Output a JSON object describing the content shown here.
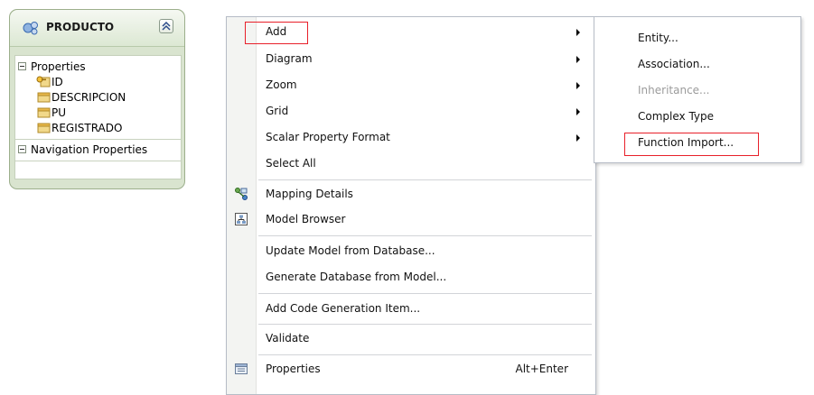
{
  "entity": {
    "title": "PRODUCTO",
    "collapse_icon": "double-chevron-up-icon",
    "properties_label": "Properties",
    "properties": [
      "ID",
      "DESCRIPCION",
      "PU",
      "REGISTRADO"
    ],
    "navigation_label": "Navigation Properties"
  },
  "menu": {
    "add": "Add",
    "diagram": "Diagram",
    "zoom": "Zoom",
    "grid": "Grid",
    "scalar_property_format": "Scalar Property Format",
    "select_all": "Select All",
    "mapping_details": "Mapping Details",
    "model_browser": "Model Browser",
    "update_model": "Update Model from Database...",
    "generate_database": "Generate Database from Model...",
    "add_code_generation": "Add Code Generation Item...",
    "validate": "Validate",
    "properties": "Properties",
    "properties_shortcut": "Alt+Enter"
  },
  "submenu": {
    "entity": "Entity...",
    "association": "Association...",
    "inheritance": "Inheritance...",
    "complex_type": "Complex Type",
    "function_import": "Function Import..."
  },
  "colors": {
    "highlight": "#e8202a",
    "entity_fill": "#d9e4cf",
    "disabled_text": "#9b9b9b"
  }
}
